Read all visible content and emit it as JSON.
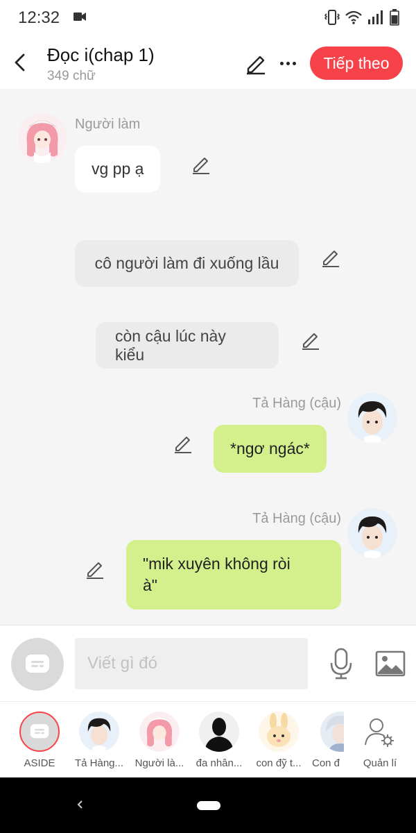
{
  "status_bar": {
    "time": "12:32"
  },
  "header": {
    "title": "Đọc i(chap 1)",
    "subtitle": "349 chữ",
    "next_button": "Tiếp theo"
  },
  "messages": [
    {
      "type": "character",
      "name": "Người làm",
      "text": "vg pp ạ"
    },
    {
      "type": "narration",
      "text": "cô người làm đi xuống lầu"
    },
    {
      "type": "narration",
      "text": "còn cậu lúc này kiểu"
    },
    {
      "type": "self",
      "name": "Tả Hàng (cậu)",
      "text": "*ngơ ngác*"
    },
    {
      "type": "self",
      "name": "Tả Hàng (cậu)",
      "text_line1": "\"mik xuyên không ròi",
      "text_line2": "à\""
    }
  ],
  "composer": {
    "placeholder": "Viết gì đó"
  },
  "characters": [
    {
      "label": "ASIDE"
    },
    {
      "label": "Tả Hàng..."
    },
    {
      "label": "Người là..."
    },
    {
      "label": "đa nhân..."
    },
    {
      "label": "con đỹ t..."
    },
    {
      "label": "Con đ"
    },
    {
      "label": "Quản lí"
    }
  ],
  "colors": {
    "accent": "#f8424a",
    "self_bubble": "#d3f08c",
    "narration_bubble": "#ebebeb",
    "background": "#f5f5f5"
  }
}
